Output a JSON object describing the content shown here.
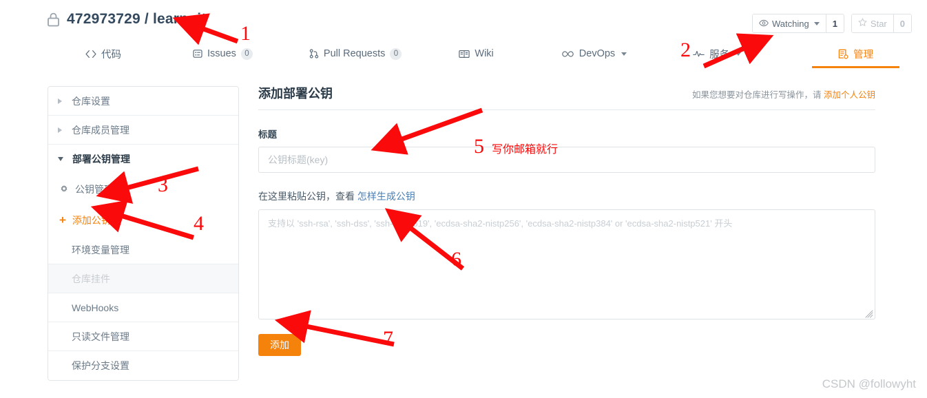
{
  "header": {
    "lock_icon": "lock-icon",
    "repo_owner": "472973729",
    "separator": "/",
    "repo_name": "learngit",
    "watch": {
      "icon": "eye-icon",
      "label": "Watching",
      "count": "1"
    },
    "star": {
      "icon": "star-icon",
      "label": "Star",
      "count": "0"
    }
  },
  "nav_tabs": [
    {
      "label": "代码",
      "icon": "code-icon",
      "badge": null,
      "active": false,
      "caret": false
    },
    {
      "label": "Issues",
      "icon": "issue-icon",
      "badge": "0",
      "active": false,
      "caret": false
    },
    {
      "label": "Pull Requests",
      "icon": "pull-request-icon",
      "badge": "0",
      "active": false,
      "caret": false
    },
    {
      "label": "Wiki",
      "icon": "book-icon",
      "badge": null,
      "active": false,
      "caret": false
    },
    {
      "label": "DevOps",
      "icon": "infinity-icon",
      "badge": null,
      "active": false,
      "caret": true
    },
    {
      "label": "服务",
      "icon": "pulse-icon",
      "badge": null,
      "active": false,
      "caret": true
    },
    {
      "label": "管理",
      "icon": "settings-list-icon",
      "badge": null,
      "active": true,
      "caret": false
    }
  ],
  "sidebar": {
    "items": [
      {
        "label": "仓库设置",
        "icon": "triangle-right-icon",
        "state": "collapsed"
      },
      {
        "label": "仓库成员管理",
        "icon": "triangle-right-icon",
        "state": "collapsed"
      },
      {
        "label": "部署公钥管理",
        "icon": "triangle-down-icon",
        "state": "expanded"
      },
      {
        "label": "公钥管理",
        "icon": "gear-icon",
        "state": "sub"
      },
      {
        "label": "添加公钥",
        "icon": "plus-icon",
        "state": "sub-active"
      },
      {
        "label": "环境变量管理",
        "icon": null,
        "state": "plain"
      },
      {
        "label": "仓库挂件",
        "icon": null,
        "state": "disabled"
      },
      {
        "label": "WebHooks",
        "icon": null,
        "state": "plain"
      },
      {
        "label": "只读文件管理",
        "icon": null,
        "state": "plain"
      },
      {
        "label": "保护分支设置",
        "icon": null,
        "state": "plain"
      }
    ]
  },
  "main": {
    "title": "添加部署公钥",
    "hint_prefix": "如果您想要对仓库进行写操作，请",
    "hint_link": "添加个人公钥",
    "title_field": {
      "label": "标题",
      "value": "",
      "placeholder": "公钥标题(key)"
    },
    "key_field": {
      "label_prefix": "在这里粘贴公钥，查看",
      "label_link": "怎样生成公钥",
      "value": "",
      "placeholder": "支持以 'ssh-rsa', 'ssh-dss', 'ssh-ed25519', 'ecdsa-sha2-nistp256', 'ecdsa-sha2-nistp384' or 'ecdsa-sha2-nistp521' 开头"
    },
    "submit_label": "添加"
  },
  "annotations": {
    "numbers": [
      "1",
      "2",
      "3",
      "4",
      "5",
      "6",
      "7"
    ],
    "note_5": "写你邮箱就行",
    "color": "#fa0a0a"
  },
  "watermark": "CSDN @followyht",
  "colors": {
    "accent": "#f5820b",
    "text": "#2c3e50",
    "muted": "#8a949d",
    "border": "#dfe3e6",
    "link": "#4a7fb5"
  }
}
